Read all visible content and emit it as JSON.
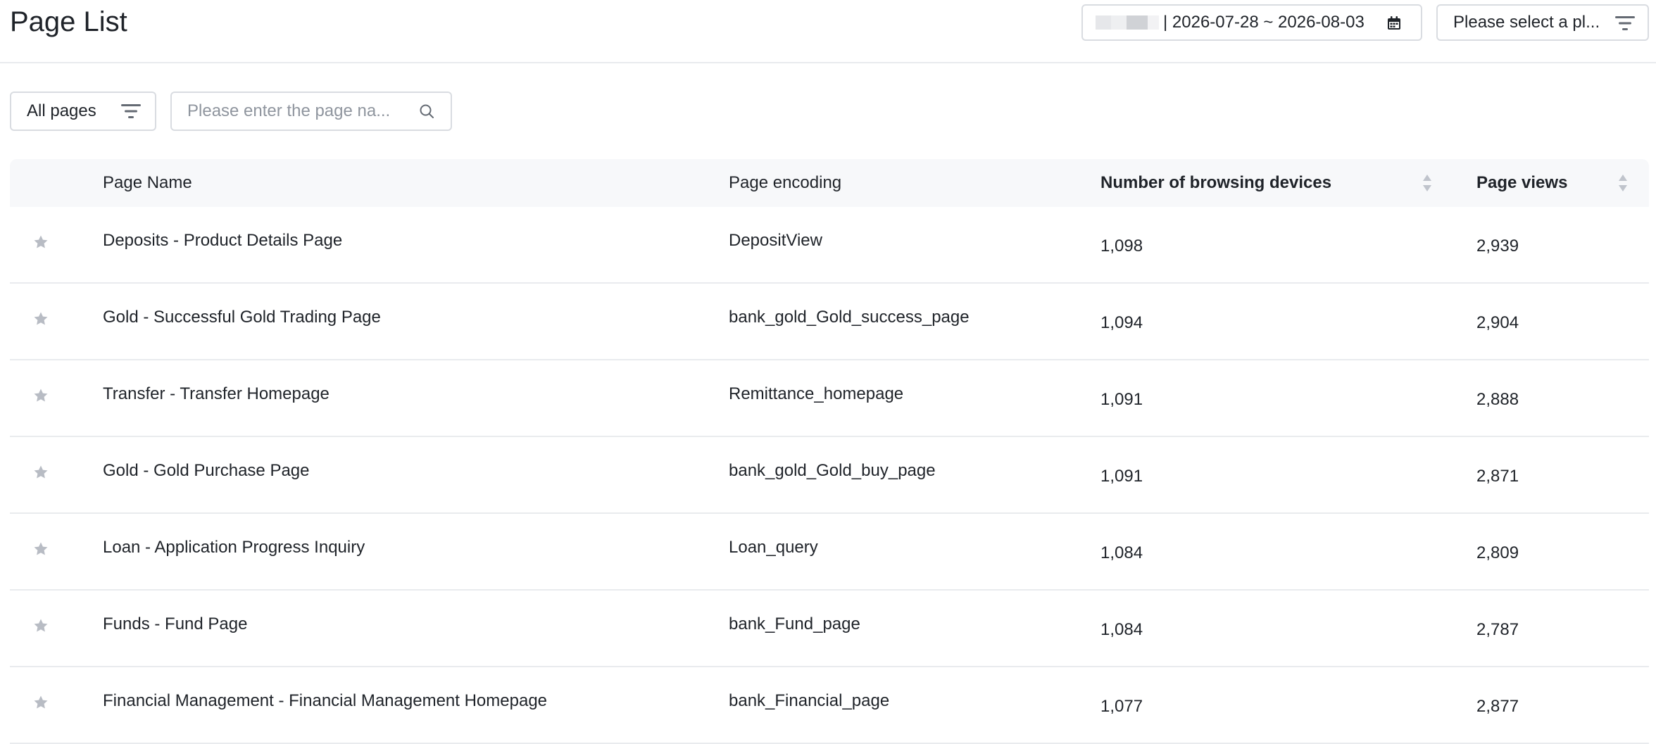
{
  "header": {
    "title": "Page List",
    "date_range": "| 2026-07-28 ~ 2026-08-03",
    "platform_placeholder": "Please select a pl..."
  },
  "filters": {
    "all_pages_label": "All pages",
    "search_placeholder": "Please enter the page na..."
  },
  "table": {
    "columns": {
      "page_name": "Page Name",
      "page_encoding": "Page encoding",
      "devices": "Number of browsing devices",
      "page_views": "Page views"
    },
    "rows": [
      {
        "name": "Deposits - Product Details Page",
        "encoding": "DepositView",
        "devices": "1,098",
        "views": "2,939"
      },
      {
        "name": "Gold - Successful Gold Trading Page",
        "encoding": "bank_gold_Gold_success_page",
        "devices": "1,094",
        "views": "2,904"
      },
      {
        "name": "Transfer - Transfer Homepage",
        "encoding": "Remittance_homepage",
        "devices": "1,091",
        "views": "2,888"
      },
      {
        "name": "Gold - Gold Purchase Page",
        "encoding": "bank_gold_Gold_buy_page",
        "devices": "1,091",
        "views": "2,871"
      },
      {
        "name": "Loan - Application Progress Inquiry",
        "encoding": "Loan_query",
        "devices": "1,084",
        "views": "2,809"
      },
      {
        "name": "Funds - Fund Page",
        "encoding": "bank_Fund_page",
        "devices": "1,084",
        "views": "2,787"
      },
      {
        "name": "Financial Management - Financial Management Homepage",
        "encoding": "bank_Financial_page",
        "devices": "1,077",
        "views": "2,877"
      }
    ]
  },
  "icons": {
    "calendar": "calendar-icon",
    "filter": "filter-icon",
    "search": "search-icon",
    "star": "star-icon",
    "sort": "sort-icon"
  },
  "colors": {
    "border": "#d9dce1",
    "header_bg": "#f7f8fa",
    "star": "#b8bcc4",
    "sort": "#c0c4cc"
  }
}
